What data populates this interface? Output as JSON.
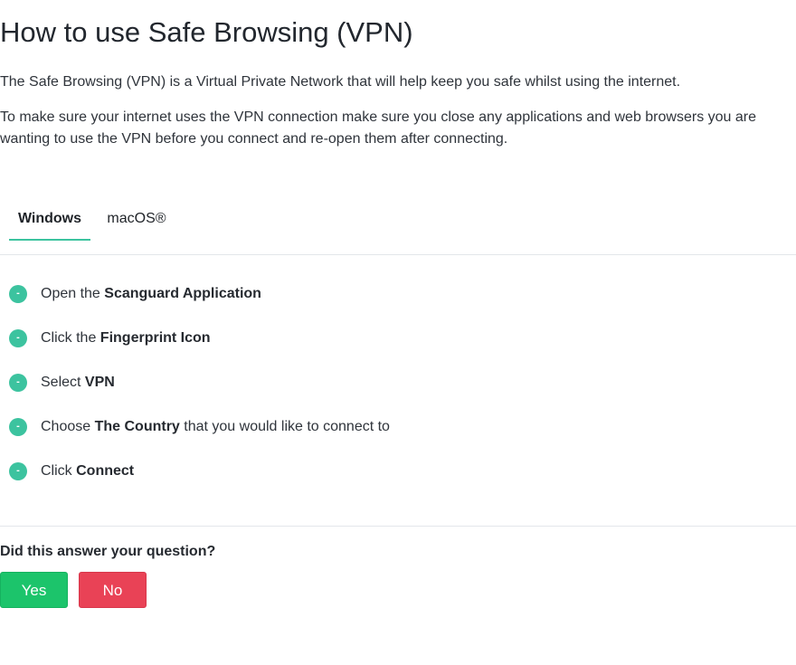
{
  "page": {
    "title": "How to use Safe Browsing (VPN)",
    "intro": "The Safe Browsing (VPN) is a Virtual Private Network that will help keep you safe whilst using the internet.",
    "instructions": "To make sure your internet uses the VPN connection make sure you close any applications and web browsers you are wanting to use the VPN before you connect and re-open them after connecting."
  },
  "tabs": {
    "windows": "Windows",
    "macos": "macOS®",
    "active": "Windows"
  },
  "steps": [
    {
      "bullet": "-",
      "before": "Open the ",
      "bold": "Scanguard Application",
      "after": ""
    },
    {
      "bullet": "-",
      "before": "Click the ",
      "bold": "Fingerprint Icon",
      "after": ""
    },
    {
      "bullet": "-",
      "before": "Select ",
      "bold": "VPN",
      "after": ""
    },
    {
      "bullet": "-",
      "before": "Choose ",
      "bold": "The Country",
      "after": " that you would like to connect to"
    },
    {
      "bullet": "-",
      "before": "Click ",
      "bold": "Connect",
      "after": ""
    }
  ],
  "feedback": {
    "question": "Did this answer your question?",
    "yes_label": "Yes",
    "no_label": "No"
  },
  "colors": {
    "accent": "#3cc39f",
    "yes": "#1cc46b",
    "no": "#e94256"
  }
}
